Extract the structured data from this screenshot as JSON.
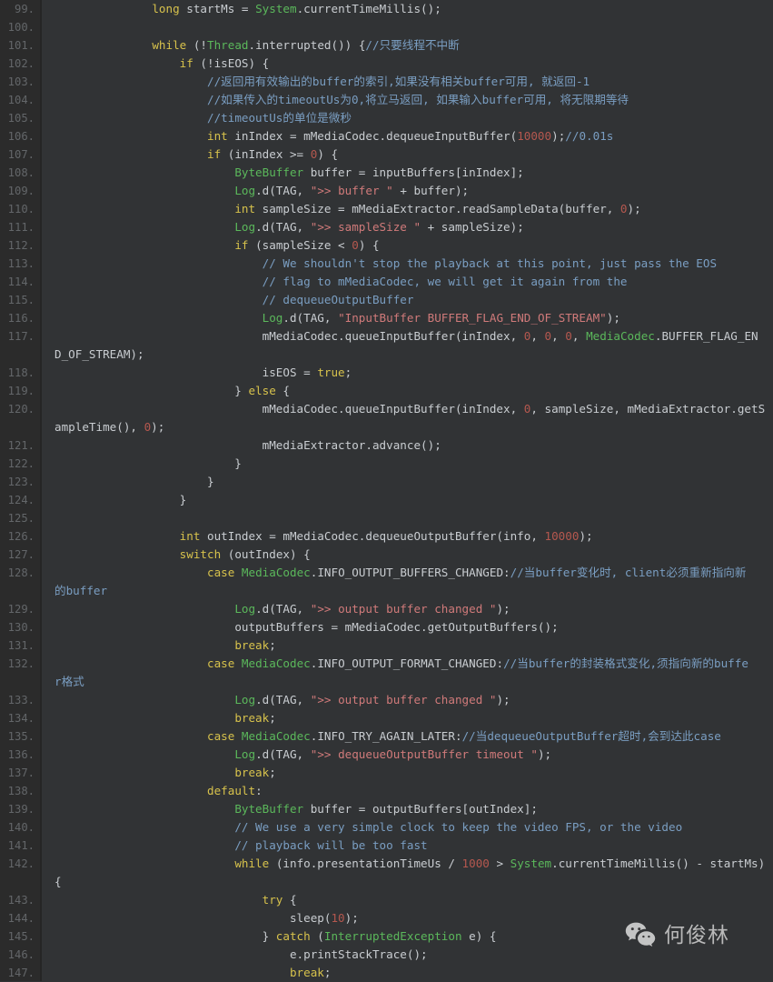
{
  "editor": {
    "theme": "darcula",
    "background": "#313335",
    "gutter_background": "#2b2b2b",
    "default_text_color": "#a9b7c6",
    "colors": {
      "keyword": "#cc7832",
      "keyword_alt": "#d7c24c",
      "type": "#5bb85b",
      "string": "#d07a7a",
      "number": "#b5584f",
      "comment": "#7a9ec2",
      "plain": "#c9cdd1",
      "line_number": "#636669"
    },
    "first_line_number": 99,
    "last_line_number": 147,
    "line_height_px": 20
  },
  "watermark": {
    "icon": "wechat-icon",
    "label": "何俊林"
  },
  "lines": [
    {
      "n": "99.",
      "wrap": false,
      "tokens": [
        {
          "t": "                ",
          "c": "pln"
        },
        {
          "t": "long",
          "c": "kw2"
        },
        {
          "t": " startMs = ",
          "c": "pln"
        },
        {
          "t": "System",
          "c": "type"
        },
        {
          "t": ".currentTimeMillis();",
          "c": "pln"
        }
      ]
    },
    {
      "n": "100.",
      "wrap": false,
      "tokens": []
    },
    {
      "n": "101.",
      "wrap": false,
      "tokens": [
        {
          "t": "                ",
          "c": "pln"
        },
        {
          "t": "while",
          "c": "kw2"
        },
        {
          "t": " (!",
          "c": "pln"
        },
        {
          "t": "Thread",
          "c": "type"
        },
        {
          "t": ".interrupted()) {",
          "c": "pln"
        },
        {
          "t": "//只要线程不中断",
          "c": "cmt"
        }
      ]
    },
    {
      "n": "102.",
      "wrap": false,
      "tokens": [
        {
          "t": "                    ",
          "c": "pln"
        },
        {
          "t": "if",
          "c": "kw2"
        },
        {
          "t": " (!isEOS) {",
          "c": "pln"
        }
      ]
    },
    {
      "n": "103.",
      "wrap": false,
      "tokens": [
        {
          "t": "                        ",
          "c": "pln"
        },
        {
          "t": "//返回用有效输出的buffer的索引,如果没有相关buffer可用, 就返回-1",
          "c": "cmt"
        }
      ]
    },
    {
      "n": "104.",
      "wrap": false,
      "tokens": [
        {
          "t": "                        ",
          "c": "pln"
        },
        {
          "t": "//如果传入的timeoutUs为0,将立马返回, 如果输入buffer可用, 将无限期等待",
          "c": "cmt"
        }
      ]
    },
    {
      "n": "105.",
      "wrap": false,
      "tokens": [
        {
          "t": "                        ",
          "c": "pln"
        },
        {
          "t": "//timeoutUs的单位是微秒",
          "c": "cmt"
        }
      ]
    },
    {
      "n": "106.",
      "wrap": false,
      "tokens": [
        {
          "t": "                        ",
          "c": "pln"
        },
        {
          "t": "int",
          "c": "kw2"
        },
        {
          "t": " inIndex = mMediaCodec.dequeueInputBuffer(",
          "c": "pln"
        },
        {
          "t": "10000",
          "c": "num"
        },
        {
          "t": ");",
          "c": "pln"
        },
        {
          "t": "//0.01s",
          "c": "cmt"
        }
      ]
    },
    {
      "n": "107.",
      "wrap": false,
      "tokens": [
        {
          "t": "                        ",
          "c": "pln"
        },
        {
          "t": "if",
          "c": "kw2"
        },
        {
          "t": " (inIndex >= ",
          "c": "pln"
        },
        {
          "t": "0",
          "c": "num"
        },
        {
          "t": ") {",
          "c": "pln"
        }
      ]
    },
    {
      "n": "108.",
      "wrap": false,
      "tokens": [
        {
          "t": "                            ",
          "c": "pln"
        },
        {
          "t": "ByteBuffer",
          "c": "type"
        },
        {
          "t": " buffer = inputBuffers[inIndex];",
          "c": "pln"
        }
      ]
    },
    {
      "n": "109.",
      "wrap": false,
      "tokens": [
        {
          "t": "                            ",
          "c": "pln"
        },
        {
          "t": "Log",
          "c": "type"
        },
        {
          "t": ".d(TAG, ",
          "c": "pln"
        },
        {
          "t": "\">> buffer \"",
          "c": "str"
        },
        {
          "t": " + buffer);",
          "c": "pln"
        }
      ]
    },
    {
      "n": "110.",
      "wrap": false,
      "tokens": [
        {
          "t": "                            ",
          "c": "pln"
        },
        {
          "t": "int",
          "c": "kw2"
        },
        {
          "t": " sampleSize = mMediaExtractor.readSampleData(buffer, ",
          "c": "pln"
        },
        {
          "t": "0",
          "c": "num"
        },
        {
          "t": ");",
          "c": "pln"
        }
      ]
    },
    {
      "n": "111.",
      "wrap": false,
      "tokens": [
        {
          "t": "                            ",
          "c": "pln"
        },
        {
          "t": "Log",
          "c": "type"
        },
        {
          "t": ".d(TAG, ",
          "c": "pln"
        },
        {
          "t": "\">> sampleSize \"",
          "c": "str"
        },
        {
          "t": " + sampleSize);",
          "c": "pln"
        }
      ]
    },
    {
      "n": "112.",
      "wrap": false,
      "tokens": [
        {
          "t": "                            ",
          "c": "pln"
        },
        {
          "t": "if",
          "c": "kw2"
        },
        {
          "t": " (sampleSize < ",
          "c": "pln"
        },
        {
          "t": "0",
          "c": "num"
        },
        {
          "t": ") {",
          "c": "pln"
        }
      ]
    },
    {
      "n": "113.",
      "wrap": false,
      "tokens": [
        {
          "t": "                                ",
          "c": "pln"
        },
        {
          "t": "// We shouldn't stop the playback at this point, just pass the EOS",
          "c": "cmt"
        }
      ]
    },
    {
      "n": "114.",
      "wrap": false,
      "tokens": [
        {
          "t": "                                ",
          "c": "pln"
        },
        {
          "t": "// flag to mMediaCodec, we will get it again from the",
          "c": "cmt"
        }
      ]
    },
    {
      "n": "115.",
      "wrap": false,
      "tokens": [
        {
          "t": "                                ",
          "c": "pln"
        },
        {
          "t": "// dequeueOutputBuffer",
          "c": "cmt"
        }
      ]
    },
    {
      "n": "116.",
      "wrap": false,
      "tokens": [
        {
          "t": "                                ",
          "c": "pln"
        },
        {
          "t": "Log",
          "c": "type"
        },
        {
          "t": ".d(TAG, ",
          "c": "pln"
        },
        {
          "t": "\"InputBuffer BUFFER_FLAG_END_OF_STREAM\"",
          "c": "str"
        },
        {
          "t": ");",
          "c": "pln"
        }
      ]
    },
    {
      "n": "117.",
      "wrap": false,
      "tokens": [
        {
          "t": "                                ",
          "c": "pln"
        },
        {
          "t": "mMediaCodec.queueInputBuffer(inIndex, ",
          "c": "pln"
        },
        {
          "t": "0",
          "c": "num"
        },
        {
          "t": ", ",
          "c": "pln"
        },
        {
          "t": "0",
          "c": "num"
        },
        {
          "t": ", ",
          "c": "pln"
        },
        {
          "t": "0",
          "c": "num"
        },
        {
          "t": ", ",
          "c": "pln"
        },
        {
          "t": "MediaCodec",
          "c": "type"
        },
        {
          "t": ".BUFFER_FLAG_EN",
          "c": "pln"
        }
      ]
    },
    {
      "n": "",
      "wrap": true,
      "tokens": [
        {
          "t": "D_OF_STREAM);",
          "c": "pln"
        }
      ]
    },
    {
      "n": "118.",
      "wrap": false,
      "tokens": [
        {
          "t": "                                ",
          "c": "pln"
        },
        {
          "t": "isEOS = ",
          "c": "pln"
        },
        {
          "t": "true",
          "c": "kw2"
        },
        {
          "t": ";",
          "c": "pln"
        }
      ]
    },
    {
      "n": "119.",
      "wrap": false,
      "tokens": [
        {
          "t": "                            } ",
          "c": "pln"
        },
        {
          "t": "else",
          "c": "kw2"
        },
        {
          "t": " {",
          "c": "pln"
        }
      ]
    },
    {
      "n": "120.",
      "wrap": false,
      "tokens": [
        {
          "t": "                                ",
          "c": "pln"
        },
        {
          "t": "mMediaCodec.queueInputBuffer(inIndex, ",
          "c": "pln"
        },
        {
          "t": "0",
          "c": "num"
        },
        {
          "t": ", sampleSize, mMediaExtractor.getS",
          "c": "pln"
        }
      ]
    },
    {
      "n": "",
      "wrap": true,
      "tokens": [
        {
          "t": "ampleTime(), ",
          "c": "pln"
        },
        {
          "t": "0",
          "c": "num"
        },
        {
          "t": ");",
          "c": "pln"
        }
      ]
    },
    {
      "n": "121.",
      "wrap": false,
      "tokens": [
        {
          "t": "                                ",
          "c": "pln"
        },
        {
          "t": "mMediaExtractor.advance();",
          "c": "pln"
        }
      ]
    },
    {
      "n": "122.",
      "wrap": false,
      "tokens": [
        {
          "t": "                            }",
          "c": "pln"
        }
      ]
    },
    {
      "n": "123.",
      "wrap": false,
      "tokens": [
        {
          "t": "                        }",
          "c": "pln"
        }
      ]
    },
    {
      "n": "124.",
      "wrap": false,
      "tokens": [
        {
          "t": "                    }",
          "c": "pln"
        }
      ]
    },
    {
      "n": "125.",
      "wrap": false,
      "tokens": []
    },
    {
      "n": "126.",
      "wrap": false,
      "tokens": [
        {
          "t": "                    ",
          "c": "pln"
        },
        {
          "t": "int",
          "c": "kw2"
        },
        {
          "t": " outIndex = mMediaCodec.dequeueOutputBuffer(info, ",
          "c": "pln"
        },
        {
          "t": "10000",
          "c": "num"
        },
        {
          "t": ");",
          "c": "pln"
        }
      ]
    },
    {
      "n": "127.",
      "wrap": false,
      "tokens": [
        {
          "t": "                    ",
          "c": "pln"
        },
        {
          "t": "switch",
          "c": "kw2"
        },
        {
          "t": " (outIndex) {",
          "c": "pln"
        }
      ]
    },
    {
      "n": "128.",
      "wrap": false,
      "tokens": [
        {
          "t": "                        ",
          "c": "pln"
        },
        {
          "t": "case",
          "c": "kw2"
        },
        {
          "t": " ",
          "c": "pln"
        },
        {
          "t": "MediaCodec",
          "c": "type"
        },
        {
          "t": ".INFO_OUTPUT_BUFFERS_CHANGED:",
          "c": "pln"
        },
        {
          "t": "//当buffer变化时, client必须重新指向新",
          "c": "cmt"
        }
      ]
    },
    {
      "n": "",
      "wrap": true,
      "tokens": [
        {
          "t": "的buffer",
          "c": "cmt"
        }
      ]
    },
    {
      "n": "129.",
      "wrap": false,
      "tokens": [
        {
          "t": "                            ",
          "c": "pln"
        },
        {
          "t": "Log",
          "c": "type"
        },
        {
          "t": ".d(TAG, ",
          "c": "pln"
        },
        {
          "t": "\">> output buffer changed \"",
          "c": "str"
        },
        {
          "t": ");",
          "c": "pln"
        }
      ]
    },
    {
      "n": "130.",
      "wrap": false,
      "tokens": [
        {
          "t": "                            ",
          "c": "pln"
        },
        {
          "t": "outputBuffers = mMediaCodec.getOutputBuffers();",
          "c": "pln"
        }
      ]
    },
    {
      "n": "131.",
      "wrap": false,
      "tokens": [
        {
          "t": "                            ",
          "c": "pln"
        },
        {
          "t": "break",
          "c": "kw2"
        },
        {
          "t": ";",
          "c": "pln"
        }
      ]
    },
    {
      "n": "132.",
      "wrap": false,
      "tokens": [
        {
          "t": "                        ",
          "c": "pln"
        },
        {
          "t": "case",
          "c": "kw2"
        },
        {
          "t": " ",
          "c": "pln"
        },
        {
          "t": "MediaCodec",
          "c": "type"
        },
        {
          "t": ".INFO_OUTPUT_FORMAT_CHANGED:",
          "c": "pln"
        },
        {
          "t": "//当buffer的封装格式变化,须指向新的buffe",
          "c": "cmt"
        }
      ]
    },
    {
      "n": "",
      "wrap": true,
      "tokens": [
        {
          "t": "r格式",
          "c": "cmt"
        }
      ]
    },
    {
      "n": "133.",
      "wrap": false,
      "tokens": [
        {
          "t": "                            ",
          "c": "pln"
        },
        {
          "t": "Log",
          "c": "type"
        },
        {
          "t": ".d(TAG, ",
          "c": "pln"
        },
        {
          "t": "\">> output buffer changed \"",
          "c": "str"
        },
        {
          "t": ");",
          "c": "pln"
        }
      ]
    },
    {
      "n": "134.",
      "wrap": false,
      "tokens": [
        {
          "t": "                            ",
          "c": "pln"
        },
        {
          "t": "break",
          "c": "kw2"
        },
        {
          "t": ";",
          "c": "pln"
        }
      ]
    },
    {
      "n": "135.",
      "wrap": false,
      "tokens": [
        {
          "t": "                        ",
          "c": "pln"
        },
        {
          "t": "case",
          "c": "kw2"
        },
        {
          "t": " ",
          "c": "pln"
        },
        {
          "t": "MediaCodec",
          "c": "type"
        },
        {
          "t": ".INFO_TRY_AGAIN_LATER:",
          "c": "pln"
        },
        {
          "t": "//当dequeueOutputBuffer超时,会到达此case",
          "c": "cmt"
        }
      ]
    },
    {
      "n": "136.",
      "wrap": false,
      "tokens": [
        {
          "t": "                            ",
          "c": "pln"
        },
        {
          "t": "Log",
          "c": "type"
        },
        {
          "t": ".d(TAG, ",
          "c": "pln"
        },
        {
          "t": "\">> dequeueOutputBuffer timeout \"",
          "c": "str"
        },
        {
          "t": ");",
          "c": "pln"
        }
      ]
    },
    {
      "n": "137.",
      "wrap": false,
      "tokens": [
        {
          "t": "                            ",
          "c": "pln"
        },
        {
          "t": "break",
          "c": "kw2"
        },
        {
          "t": ";",
          "c": "pln"
        }
      ]
    },
    {
      "n": "138.",
      "wrap": false,
      "tokens": [
        {
          "t": "                        ",
          "c": "pln"
        },
        {
          "t": "default",
          "c": "kw2"
        },
        {
          "t": ":",
          "c": "pln"
        }
      ]
    },
    {
      "n": "139.",
      "wrap": false,
      "tokens": [
        {
          "t": "                            ",
          "c": "pln"
        },
        {
          "t": "ByteBuffer",
          "c": "type"
        },
        {
          "t": " buffer = outputBuffers[outIndex];",
          "c": "pln"
        }
      ]
    },
    {
      "n": "140.",
      "wrap": false,
      "tokens": [
        {
          "t": "                            ",
          "c": "pln"
        },
        {
          "t": "// We use a very simple clock to keep the video FPS, or the video",
          "c": "cmt"
        }
      ]
    },
    {
      "n": "141.",
      "wrap": false,
      "tokens": [
        {
          "t": "                            ",
          "c": "pln"
        },
        {
          "t": "// playback will be too fast",
          "c": "cmt"
        }
      ]
    },
    {
      "n": "142.",
      "wrap": false,
      "tokens": [
        {
          "t": "                            ",
          "c": "pln"
        },
        {
          "t": "while",
          "c": "kw2"
        },
        {
          "t": " (info.presentationTimeUs / ",
          "c": "pln"
        },
        {
          "t": "1000",
          "c": "num"
        },
        {
          "t": " > ",
          "c": "pln"
        },
        {
          "t": "System",
          "c": "type"
        },
        {
          "t": ".currentTimeMillis() - startMs)",
          "c": "pln"
        }
      ]
    },
    {
      "n": "",
      "wrap": true,
      "tokens": [
        {
          "t": "{",
          "c": "pln"
        }
      ]
    },
    {
      "n": "143.",
      "wrap": false,
      "tokens": [
        {
          "t": "                                ",
          "c": "pln"
        },
        {
          "t": "try",
          "c": "kw2"
        },
        {
          "t": " {",
          "c": "pln"
        }
      ]
    },
    {
      "n": "144.",
      "wrap": false,
      "tokens": [
        {
          "t": "                                    ",
          "c": "pln"
        },
        {
          "t": "sleep(",
          "c": "pln"
        },
        {
          "t": "10",
          "c": "num"
        },
        {
          "t": ");",
          "c": "pln"
        }
      ]
    },
    {
      "n": "145.",
      "wrap": false,
      "tokens": [
        {
          "t": "                                } ",
          "c": "pln"
        },
        {
          "t": "catch",
          "c": "kw2"
        },
        {
          "t": " (",
          "c": "pln"
        },
        {
          "t": "InterruptedException",
          "c": "type"
        },
        {
          "t": " e) {",
          "c": "pln"
        }
      ]
    },
    {
      "n": "146.",
      "wrap": false,
      "tokens": [
        {
          "t": "                                    ",
          "c": "pln"
        },
        {
          "t": "e.printStackTrace();",
          "c": "pln"
        }
      ]
    },
    {
      "n": "147.",
      "wrap": false,
      "tokens": [
        {
          "t": "                                    ",
          "c": "pln"
        },
        {
          "t": "break",
          "c": "kw2"
        },
        {
          "t": ";",
          "c": "pln"
        }
      ]
    }
  ]
}
